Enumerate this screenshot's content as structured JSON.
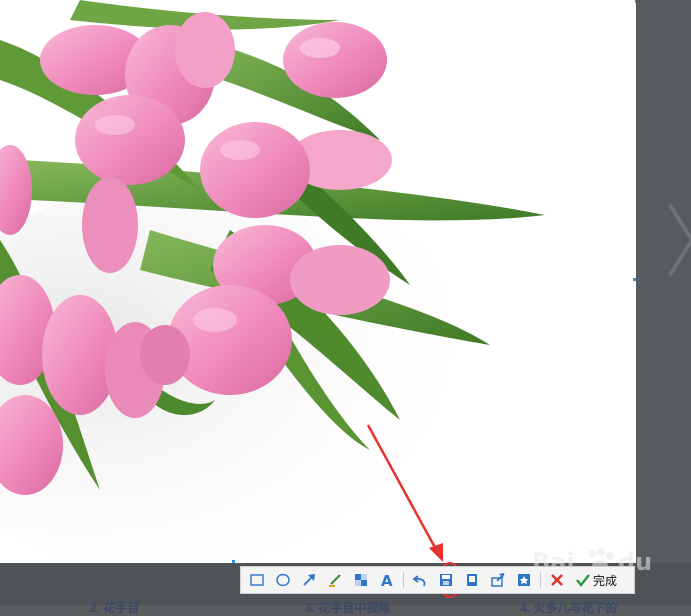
{
  "toolbar": {
    "tools": [
      {
        "icon": "rectangle-icon"
      },
      {
        "icon": "ellipse-icon"
      },
      {
        "icon": "arrow-icon"
      },
      {
        "icon": "brush-icon"
      },
      {
        "icon": "mosaic-icon"
      },
      {
        "icon": "text-icon"
      },
      {
        "icon": "undo-icon"
      },
      {
        "icon": "save-icon",
        "highlighted": true
      },
      {
        "icon": "pin-icon"
      },
      {
        "icon": "share-icon"
      },
      {
        "icon": "collect-icon"
      },
      {
        "icon": "cancel-icon"
      }
    ],
    "done_label": "完成"
  },
  "annotation": {
    "color": "#e8322f"
  },
  "colors": {
    "accent": "#2f8fe3",
    "overlay": "#5a5d60",
    "tulip_pink": "#f08fbf",
    "leaf_green": "#4d8a2e"
  },
  "page_below": {
    "peek_1": "2. 花手目",
    "peek_2": "3. 花手目中视频",
    "peek_3": "4. 火多儿与花下的"
  }
}
